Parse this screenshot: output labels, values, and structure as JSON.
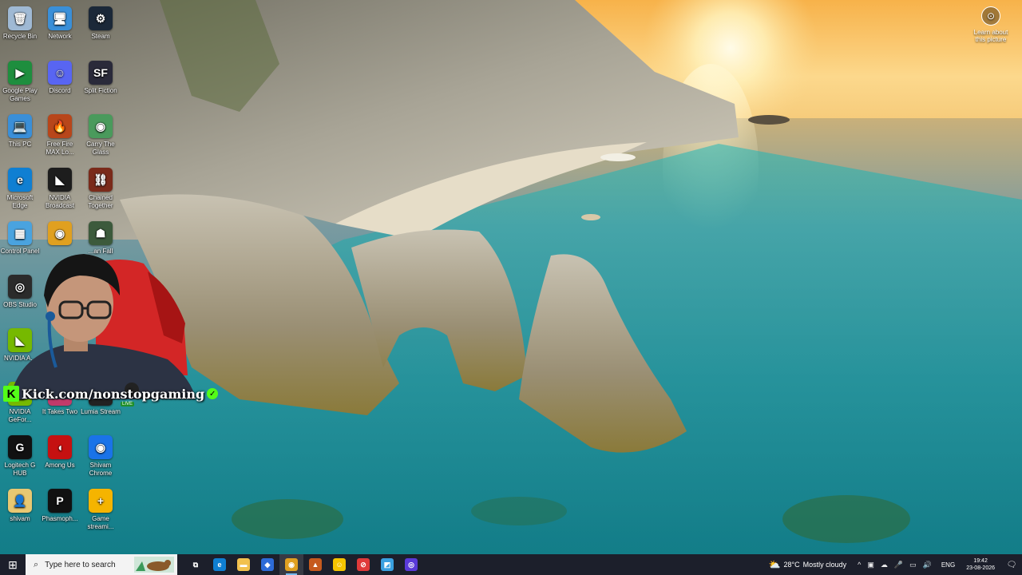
{
  "desktop_icons": [
    {
      "name": "icon-recycle-bin",
      "label": "Recycle Bin",
      "glyph": "🗑",
      "bg": "#9fb9d4"
    },
    {
      "name": "icon-network",
      "label": "Network",
      "glyph": "🖥",
      "bg": "#3a8fd8"
    },
    {
      "name": "icon-steam",
      "label": "Steam",
      "glyph": "⚙",
      "bg": "#1b2838"
    },
    {
      "name": "icon-google-play-games",
      "label": "Google Play Games",
      "glyph": "▶",
      "bg": "#1e8e3e"
    },
    {
      "name": "icon-discord",
      "label": "Discord",
      "glyph": "☺",
      "bg": "#5865f2"
    },
    {
      "name": "icon-split-fiction",
      "label": "Split Fiction",
      "glyph": "SF",
      "bg": "#2a2a3a"
    },
    {
      "name": "icon-this-pc",
      "label": "This PC",
      "glyph": "💻",
      "bg": "#3a8fd8"
    },
    {
      "name": "icon-free-fire",
      "label": "Free Fire MAX Lo...",
      "glyph": "🔥",
      "bg": "#b8461a"
    },
    {
      "name": "icon-carry-the-glass",
      "label": "Carry The Glass",
      "glyph": "◉",
      "bg": "#4a9a5c"
    },
    {
      "name": "icon-microsoft-edge",
      "label": "Microsoft Edge",
      "glyph": "e",
      "bg": "#0f7fd2"
    },
    {
      "name": "icon-nvidia-broadcast",
      "label": "NVIDIA Broadcast",
      "glyph": "◣",
      "bg": "#1d1d1d"
    },
    {
      "name": "icon-chained-together",
      "label": "Chained Together",
      "glyph": "⛓",
      "bg": "#7a2a1a"
    },
    {
      "name": "icon-control-panel",
      "label": "Control Panel",
      "glyph": "▦",
      "bg": "#4aa3df"
    },
    {
      "name": "icon-google-chrome",
      "label": "",
      "glyph": "◉",
      "bg": "#e0a020"
    },
    {
      "name": "icon-man-fall",
      "label": "...an Fall",
      "glyph": "☗",
      "bg": "#3c5a3c"
    },
    {
      "name": "icon-obs-studio",
      "label": "OBS Studio",
      "glyph": "◎",
      "bg": "#2b2b2b"
    },
    {
      "name": "icon-nvidia-app",
      "label": "NVIDIA A...",
      "glyph": "◣",
      "bg": "#76b900"
    },
    {
      "name": "icon-nvidia-geforce",
      "label": "NVIDIA GeFor...",
      "glyph": "◣",
      "bg": "#76b900"
    },
    {
      "name": "icon-it-takes-two",
      "label": "It Takes Two",
      "glyph": "♥",
      "bg": "#c23a6a"
    },
    {
      "name": "icon-lumia-stream",
      "label": "Lumia Stream",
      "glyph": "◐",
      "bg": "#222"
    },
    {
      "name": "icon-logitech-g-hub",
      "label": "Logitech G HUB",
      "glyph": "G",
      "bg": "#111"
    },
    {
      "name": "icon-among-us",
      "label": "Among Us",
      "glyph": "◖",
      "bg": "#c51111"
    },
    {
      "name": "icon-shivam-chrome",
      "label": "Shivam Chrome",
      "glyph": "◉",
      "bg": "#1a73e8"
    },
    {
      "name": "icon-shivam",
      "label": "shivam",
      "glyph": "👤",
      "bg": "#e8c872"
    },
    {
      "name": "icon-phasmophobia",
      "label": "Phasmoph...",
      "glyph": "P",
      "bg": "#111"
    },
    {
      "name": "icon-game-streaming",
      "label": "Game streami...",
      "glyph": "+",
      "bg": "#f5b400"
    }
  ],
  "learn_about": {
    "label": "Learn about this picture",
    "glyph": "⊙"
  },
  "overlay": {
    "logo": "K",
    "handle": "Kick.com/nonstopgaming",
    "verified": "✓",
    "live_badge": "LIVE"
  },
  "taskbar": {
    "start_glyph": "⊞",
    "search_icon": "⌕",
    "search_placeholder": "Type here to search",
    "apps": [
      {
        "name": "taskbar-task-view",
        "glyph": "⧉",
        "bg": "transparent",
        "active": false
      },
      {
        "name": "taskbar-edge",
        "glyph": "e",
        "bg": "#0f7fd2",
        "active": false
      },
      {
        "name": "taskbar-file-explorer",
        "glyph": "▬",
        "bg": "#f2c14e",
        "active": false
      },
      {
        "name": "taskbar-app-blue",
        "glyph": "◆",
        "bg": "#2d6bd8",
        "active": false
      },
      {
        "name": "taskbar-chrome",
        "glyph": "◉",
        "bg": "#e0a020",
        "active": true
      },
      {
        "name": "taskbar-game-orange",
        "glyph": "▲",
        "bg": "#c65a1e",
        "active": false
      },
      {
        "name": "taskbar-app-yellow",
        "glyph": "☺",
        "bg": "#f5c400",
        "active": false
      },
      {
        "name": "taskbar-app-red",
        "glyph": "⊘",
        "bg": "#e03a3a",
        "active": false
      },
      {
        "name": "taskbar-app-lightblue",
        "glyph": "◩",
        "bg": "#3aa0e0",
        "active": false
      },
      {
        "name": "taskbar-obs",
        "glyph": "◎",
        "bg": "#5a3ad8",
        "active": false
      }
    ],
    "weather": {
      "glyph": "⛅",
      "temp": "28°C",
      "condition": "Mostly cloudy"
    },
    "tray_symbols": [
      "^",
      "▣",
      "☁",
      "🎤",
      "▭",
      "🔊"
    ],
    "language": "ENG",
    "time": "19:42",
    "date": "23-08-2026",
    "notification_glyph": "🗨"
  }
}
